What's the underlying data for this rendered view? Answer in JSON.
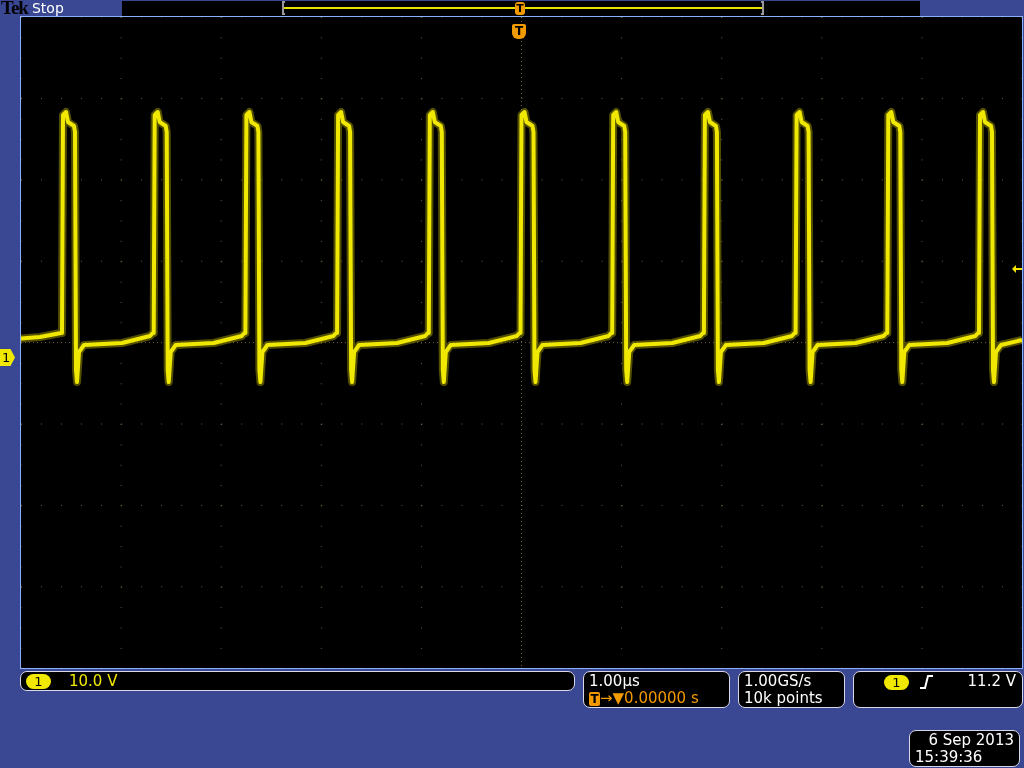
{
  "header": {
    "brand": "Tek",
    "status": "Stop"
  },
  "record_view": {
    "trigger_label": "T"
  },
  "display": {
    "trigger_label": "T",
    "channel_marker": "1"
  },
  "channel": {
    "number": "1",
    "scale": "10.0 V"
  },
  "timebase": {
    "scale": "1.00µs",
    "delay_badge": "T",
    "delay_arrows": "→▼",
    "delay": "0.00000 s"
  },
  "acquisition": {
    "sample_rate": "1.00GS/s",
    "record_length": "10k points"
  },
  "trigger": {
    "source": "1",
    "rising_slope": true,
    "level": "11.2 V"
  },
  "clock": {
    "date": "6 Sep 2013",
    "time": "15:39:36"
  }
}
